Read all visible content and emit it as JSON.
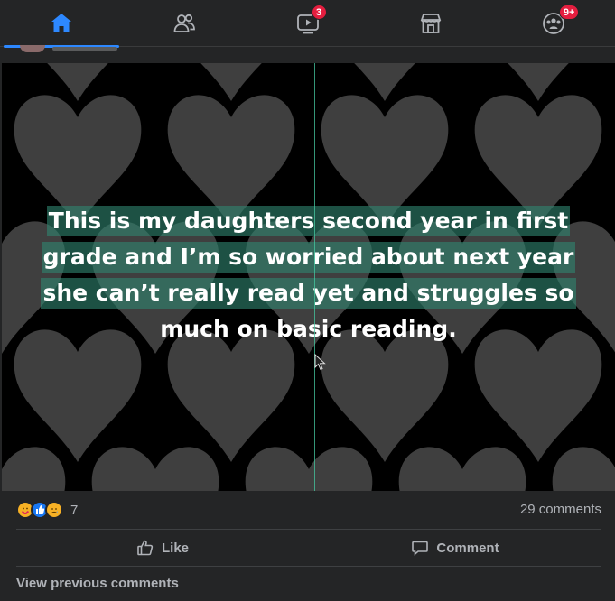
{
  "nav": {
    "tabs": [
      {
        "name": "home",
        "icon": "home-icon",
        "active": true
      },
      {
        "name": "friends",
        "icon": "friends-icon",
        "active": false
      },
      {
        "name": "watch",
        "icon": "watch-icon",
        "active": false,
        "badge": "3"
      },
      {
        "name": "marketplace",
        "icon": "marketplace-icon",
        "active": false
      },
      {
        "name": "groups",
        "icon": "groups-icon",
        "active": false,
        "badge": "9+"
      }
    ]
  },
  "post": {
    "caption_lines": [
      "This is my daughters second year in first",
      "grade and I’m so worried about next year",
      "she can’t really read yet and struggles so",
      "much on basic reading."
    ],
    "reaction_icons": [
      "care-reaction-icon",
      "like-reaction-icon",
      "sad-reaction-icon"
    ],
    "reaction_count": "7",
    "comments_count": "29 comments",
    "actions": {
      "like": "Like",
      "comment": "Comment"
    },
    "view_previous": "View previous comments"
  },
  "colors": {
    "background": "#242526",
    "accent": "#2d88ff",
    "badge": "#e41e3f",
    "caption_highlight": "#2e826e",
    "secondary_text": "#b0b3b8"
  }
}
